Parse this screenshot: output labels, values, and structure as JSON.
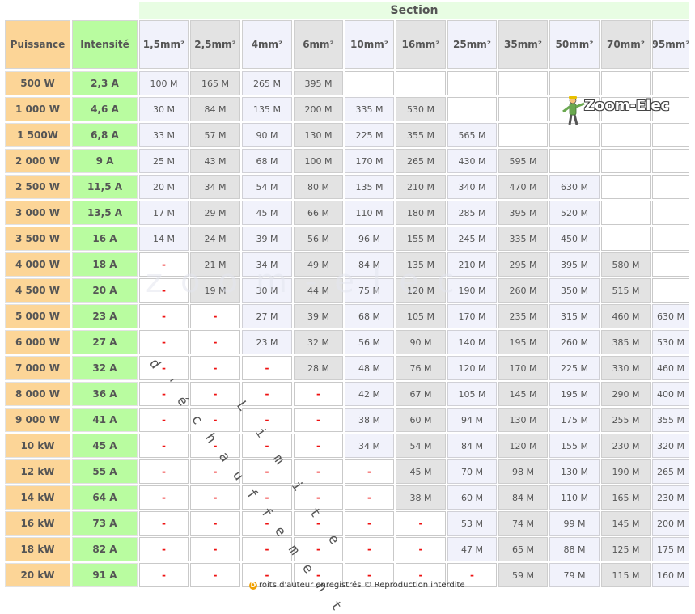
{
  "section_title": "Section",
  "col_power": "Puissance",
  "col_current": "Intensité",
  "sections": [
    "1,5mm²",
    "2,5mm²",
    "4mm²",
    "6mm²",
    "10mm²",
    "16mm²",
    "25mm²",
    "35mm²",
    "50mm²",
    "70mm²",
    "95mm²"
  ],
  "rows": [
    {
      "power": "500 W",
      "current": "2,3 A",
      "cells": [
        "100 M",
        "165 M",
        "265 M",
        "395 M",
        "",
        "",
        "",
        "",
        "",
        "",
        ""
      ]
    },
    {
      "power": "1 000 W",
      "current": "4,6 A",
      "cells": [
        "30 M",
        "84 M",
        "135 M",
        "200 M",
        "335 M",
        "530 M",
        "",
        "",
        "",
        "",
        ""
      ]
    },
    {
      "power": "1 500W",
      "current": "6,8 A",
      "cells": [
        "33 M",
        "57 M",
        "90 M",
        "130 M",
        "225 M",
        "355 M",
        "565 M",
        "",
        "",
        "",
        ""
      ]
    },
    {
      "power": "2 000 W",
      "current": "9 A",
      "cells": [
        "25 M",
        "43 M",
        "68 M",
        "100 M",
        "170 M",
        "265 M",
        "430 M",
        "595 M",
        "",
        "",
        ""
      ]
    },
    {
      "power": "2 500 W",
      "current": "11,5 A",
      "cells": [
        "20 M",
        "34 M",
        "54 M",
        "80 M",
        "135 M",
        "210 M",
        "340 M",
        "470 M",
        "630 M",
        "",
        ""
      ]
    },
    {
      "power": "3 000 W",
      "current": "13,5 A",
      "cells": [
        "17 M",
        "29 M",
        "45 M",
        "66 M",
        "110 M",
        "180 M",
        "285 M",
        "395 M",
        "520 M",
        "",
        ""
      ]
    },
    {
      "power": "3 500 W",
      "current": "16 A",
      "cells": [
        "14 M",
        "24 M",
        "39 M",
        "56 M",
        "96 M",
        "155 M",
        "245 M",
        "335 M",
        "450 M",
        "",
        ""
      ]
    },
    {
      "power": "4 000 W",
      "current": "18 A",
      "cells": [
        "-",
        "21 M",
        "34 M",
        "49 M",
        "84 M",
        "135 M",
        "210 M",
        "295 M",
        "395 M",
        "580 M",
        ""
      ]
    },
    {
      "power": "4 500 W",
      "current": "20 A",
      "cells": [
        "-",
        "19 M",
        "30 M",
        "44 M",
        "75 M",
        "120 M",
        "190 M",
        "260 M",
        "350 M",
        "515 M",
        ""
      ]
    },
    {
      "power": "5 000 W",
      "current": "23 A",
      "cells": [
        "-",
        "-",
        "27 M",
        "39 M",
        "68 M",
        "105 M",
        "170 M",
        "235 M",
        "315 M",
        "460 M",
        "630 M"
      ]
    },
    {
      "power": "6 000 W",
      "current": "27 A",
      "cells": [
        "-",
        "-",
        "23 M",
        "32 M",
        "56 M",
        "90 M",
        "140 M",
        "195 M",
        "260 M",
        "385 M",
        "530 M"
      ]
    },
    {
      "power": "7 000 W",
      "current": "32 A",
      "cells": [
        "-",
        "-",
        "-",
        "28 M",
        "48 M",
        "76 M",
        "120 M",
        "170 M",
        "225 M",
        "330 M",
        "460 M"
      ]
    },
    {
      "power": "8 000 W",
      "current": "36 A",
      "cells": [
        "-",
        "-",
        "-",
        "-",
        "42 M",
        "67 M",
        "105 M",
        "145 M",
        "195 M",
        "290 M",
        "400 M"
      ]
    },
    {
      "power": "9 000 W",
      "current": "41 A",
      "cells": [
        "-",
        "-",
        "-",
        "-",
        "38 M",
        "60 M",
        "94 M",
        "130 M",
        "175 M",
        "255 M",
        "355 M"
      ]
    },
    {
      "power": "10 kW",
      "current": "45 A",
      "cells": [
        "-",
        "-",
        "-",
        "-",
        "34 M",
        "54 M",
        "84 M",
        "120 M",
        "155 M",
        "230 M",
        "320 M"
      ]
    },
    {
      "power": "12 kW",
      "current": "55 A",
      "cells": [
        "-",
        "-",
        "-",
        "-",
        "-",
        "45 M",
        "70 M",
        "98 M",
        "130 M",
        "190 M",
        "265 M"
      ]
    },
    {
      "power": "14 kW",
      "current": "64 A",
      "cells": [
        "-",
        "-",
        "-",
        "-",
        "-",
        "38 M",
        "60 M",
        "84 M",
        "110 M",
        "165 M",
        "230 M"
      ]
    },
    {
      "power": "16 kW",
      "current": "73 A",
      "cells": [
        "-",
        "-",
        "-",
        "-",
        "-",
        "-",
        "53 M",
        "74 M",
        "99 M",
        "145 M",
        "200 M"
      ]
    },
    {
      "power": "18 kW",
      "current": "82 A",
      "cells": [
        "-",
        "-",
        "-",
        "-",
        "-",
        "-",
        "47 M",
        "65 M",
        "88 M",
        "125 M",
        "175 M"
      ]
    },
    {
      "power": "20 kW",
      "current": "91 A",
      "cells": [
        "-",
        "-",
        "-",
        "-",
        "-",
        "-",
        "-",
        "59 M",
        "79 M",
        "115 M",
        "160 M"
      ]
    }
  ],
  "logo_text": "Zoom-Elec",
  "watermark_text": "zoom-elec",
  "annotation_text": "Limite d'échauffement",
  "copyright_mark": "D",
  "copyright_text": "roits d'auteur enregistrés © Reproduction interdite",
  "colors": {
    "power_header": "#fcd597",
    "current_header": "#b9fca0",
    "section_header": "#e8fde3",
    "dash": "#ee1111"
  }
}
